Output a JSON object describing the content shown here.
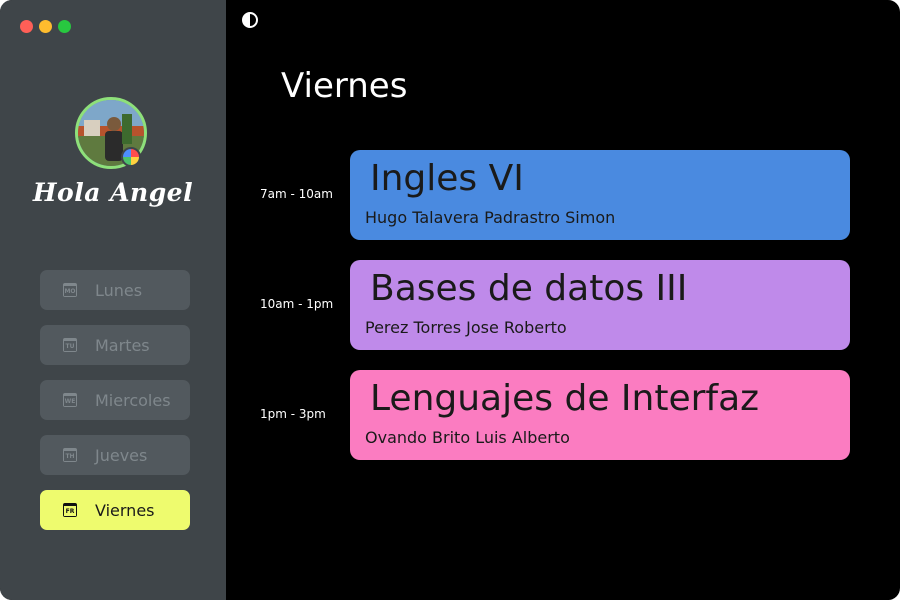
{
  "window": {
    "controls": [
      {
        "name": "close",
        "color": "#ff5f57"
      },
      {
        "name": "minimize",
        "color": "#febc2e"
      },
      {
        "name": "maximize",
        "color": "#28c840"
      }
    ]
  },
  "sidebar": {
    "greeting": "Hola Angel",
    "items": [
      {
        "label": "Lunes",
        "icon": "MO",
        "icon_name": "calendar-icon",
        "active": false
      },
      {
        "label": "Martes",
        "icon": "TU",
        "icon_name": "calendar-icon",
        "active": false
      },
      {
        "label": "Miercoles",
        "icon": "WE",
        "icon_name": "calendar-icon",
        "active": false
      },
      {
        "label": "Jueves",
        "icon": "TH",
        "icon_name": "calendar-icon",
        "active": false
      },
      {
        "label": "Viernes",
        "icon": "FR",
        "icon_name": "calendar-icon",
        "active": true
      }
    ]
  },
  "main": {
    "theme_icon": "contrast-icon",
    "day_title": "Viernes",
    "classes": [
      {
        "time": "7am - 10am",
        "subject": "Ingles VI",
        "teacher": "Hugo Talavera Padrastro Simon",
        "color": "#4a8ae0"
      },
      {
        "time": "10am - 1pm",
        "subject": "Bases de datos III",
        "teacher": "Perez Torres Jose Roberto",
        "color": "#bf8aea"
      },
      {
        "time": "1pm - 3pm",
        "subject": "Lenguajes de Interfaz",
        "teacher": "Ovando Brito Luis Alberto",
        "color": "#fb7cc1"
      }
    ]
  },
  "colors": {
    "sidebar_bg": "#3f4549",
    "nav_bg": "#52595e",
    "nav_active_bg": "#eefb6e",
    "avatar_ring": "#8ee07a",
    "main_bg": "#000000"
  }
}
